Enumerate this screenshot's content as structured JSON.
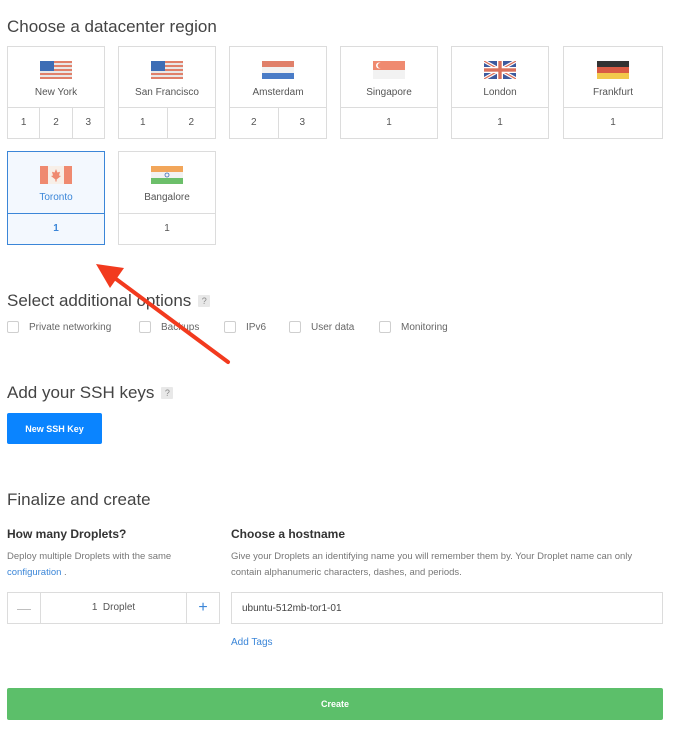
{
  "datacenter": {
    "title": "Choose a datacenter region",
    "regions": [
      {
        "name": "New York",
        "flag": "us-flag-icon",
        "numbers": [
          "1",
          "2",
          "3"
        ],
        "selected": false
      },
      {
        "name": "San Francisco",
        "flag": "us-flag-icon",
        "numbers": [
          "1",
          "2"
        ],
        "selected": false
      },
      {
        "name": "Amsterdam",
        "flag": "netherlands-flag-icon",
        "numbers": [
          "2",
          "3"
        ],
        "selected": false
      },
      {
        "name": "Singapore",
        "flag": "singapore-flag-icon",
        "numbers": [
          "1"
        ],
        "selected": false
      },
      {
        "name": "London",
        "flag": "uk-flag-icon",
        "numbers": [
          "1"
        ],
        "selected": false
      },
      {
        "name": "Frankfurt",
        "flag": "germany-flag-icon",
        "numbers": [
          "1"
        ],
        "selected": false
      },
      {
        "name": "Toronto",
        "flag": "canada-flag-icon",
        "numbers": [
          "1"
        ],
        "selected": true
      },
      {
        "name": "Bangalore",
        "flag": "india-flag-icon",
        "numbers": [
          "1"
        ],
        "selected": false
      }
    ]
  },
  "options": {
    "title": "Select additional options",
    "help": "?",
    "items": [
      {
        "label": "Private networking"
      },
      {
        "label": "Backups"
      },
      {
        "label": "IPv6"
      },
      {
        "label": "User data"
      },
      {
        "label": "Monitoring"
      }
    ]
  },
  "ssh": {
    "title": "Add your SSH keys",
    "help": "?",
    "button": "New SSH Key"
  },
  "finalize": {
    "title": "Finalize and create",
    "droplets": {
      "title": "How many Droplets?",
      "desc": "Deploy multiple Droplets with the same",
      "link": "configuration",
      "desc_end": ".",
      "minus": "—",
      "count_text": "1  Droplet",
      "plus": "+"
    },
    "hostname": {
      "title": "Choose a hostname",
      "desc": "Give your Droplets an identifying name you will remember them by. Your Droplet name can only contain alphanumeric characters, dashes, and periods.",
      "value": "ubuntu-512mb-tor1-01",
      "add_tags": "Add Tags"
    },
    "create": "Create"
  },
  "colors": {
    "accent": "#3b86d8",
    "primary_button": "#0a84ff",
    "create_button": "#5cbf6a",
    "annotation_arrow": "#f23a1e"
  }
}
